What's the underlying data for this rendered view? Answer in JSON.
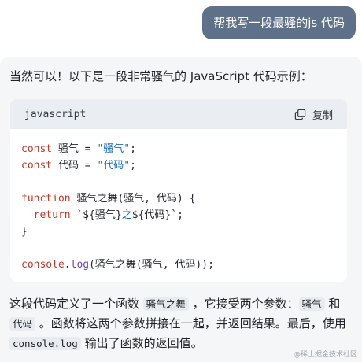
{
  "user_message": "帮我写一段最骚的js 代码",
  "reply": {
    "intro": "当然可以！以下是一段非常骚气的 JavaScript 代码示例：",
    "code_block": {
      "language": "javascript",
      "copy_label": "复制",
      "copy_icon": "copy-icon",
      "lines": [
        [
          {
            "t": "const",
            "c": "kw"
          },
          {
            "t": " 骚气 = "
          },
          {
            "t": "\"骚气\"",
            "c": "str"
          },
          {
            "t": ";"
          }
        ],
        [
          {
            "t": "const",
            "c": "kw"
          },
          {
            "t": " 代码 = "
          },
          {
            "t": "\"代码\"",
            "c": "str"
          },
          {
            "t": ";"
          }
        ],
        [],
        [
          {
            "t": "function",
            "c": "kw"
          },
          {
            "t": " 骚气之舞(骚气, 代码) {"
          }
        ],
        [
          {
            "t": "  return",
            "c": "kw"
          },
          {
            "t": " `${骚气}"
          },
          {
            "t": "之",
            "c": "str"
          },
          {
            "t": "${代码}`;"
          }
        ],
        [
          {
            "t": "}"
          }
        ],
        [],
        [
          {
            "t": "console",
            "c": "kw"
          },
          {
            "t": "."
          },
          {
            "t": "log",
            "c": "fn"
          },
          {
            "t": "(骚气之舞(骚气, 代码));"
          }
        ]
      ]
    },
    "explanation": {
      "p1": "这段代码定义了一个函数 ",
      "code1": "骚气之舞",
      "p2": " ，它接受两个参数：",
      "code2": "骚气",
      "p3": " 和 ",
      "code3": "代码",
      "p4": " 。函数将这两个参数拼接在一起，并返回结果。最后，使用 ",
      "code4": "console.log",
      "p5": " 输出了函数的返回值。"
    }
  },
  "watermark": "@稀土掘金技术社区",
  "colors": {
    "user_bubble": "#5f7188",
    "keyword": "#c0392b",
    "string": "#1a6ac0",
    "function": "#6f42c1"
  }
}
